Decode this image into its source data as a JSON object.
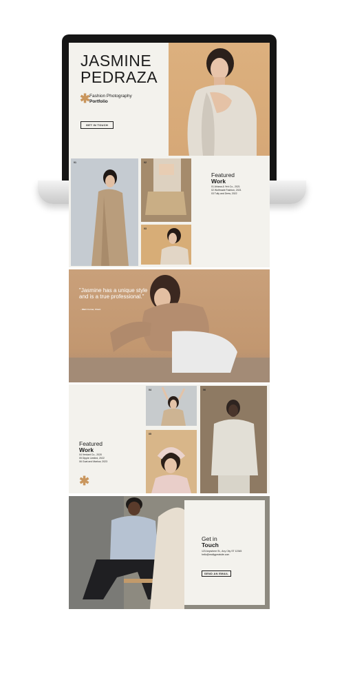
{
  "hero": {
    "name": "JASMINE\nPEDRAZA",
    "subtitle": "Fashion Photography",
    "subtitle_bold": "Portfolio",
    "cta": "GET IN TOUCH"
  },
  "featured1": {
    "tiles": [
      {
        "num": "01"
      },
      {
        "num": "02"
      },
      {
        "num": "03"
      }
    ],
    "heading": "Featured",
    "heading_bold": "Work",
    "items": [
      "01 Ahiana & Yeh Co., 2021",
      "02 Wolfmade Fashion, 2021",
      "03 Tully and Drew, 2022"
    ]
  },
  "quote": {
    "text": "\"Jasmine has a unique style and is a true professional.\"",
    "author": "- Wahl Corner, Client"
  },
  "featured2": {
    "tiles": [
      {
        "num": "04"
      },
      {
        "num": "05"
      },
      {
        "num": "06"
      }
    ],
    "heading": "Featured",
    "heading_bold": "Work",
    "items": [
      "04 Verdant Co., 2020",
      "05 Dipple Limited, 2022",
      "06 Goat and Marlow, 2023"
    ]
  },
  "contact": {
    "heading": "Get in",
    "heading_bold": "Touch",
    "address": "123 Anywhere St., Any City ST 12345",
    "email": "hello@reallygreatsite.com",
    "cta": "SEND AN EMAIL"
  },
  "colors": {
    "cream": "#f3f2ed",
    "accent": "#c9965d",
    "tan": "#d6a877",
    "ink": "#1c1c1c"
  }
}
